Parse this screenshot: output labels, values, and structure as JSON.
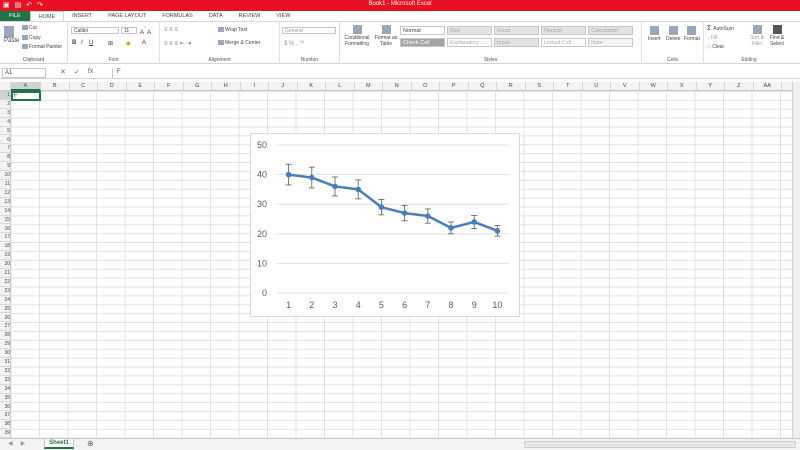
{
  "window": {
    "title": "Book1 - Microsoft Excel"
  },
  "tabs": [
    "FILE",
    "HOME",
    "INSERT",
    "PAGE LAYOUT",
    "FORMULAS",
    "DATA",
    "REVIEW",
    "VIEW"
  ],
  "ribbon": {
    "clipboard": {
      "paste": "Paste",
      "cut": "Cut",
      "copy": "Copy",
      "format_painter": "Format Painter",
      "label": "Clipboard"
    },
    "font": {
      "name": "Calibri",
      "size": "11",
      "label": "Font"
    },
    "alignment": {
      "wrap": "Wrap Text",
      "merge": "Merge & Center",
      "label": "Alignment"
    },
    "number": {
      "format": "General",
      "label": "Number"
    },
    "styles": {
      "conditional": "Conditional Formatting",
      "format_table": "Format as Table",
      "normal": "Normal",
      "bad": "Bad",
      "good": "Good",
      "neutral": "Neutral",
      "calculation": "Calculation",
      "check_cell": "Check Cell",
      "explanatory": "Explanatory ...",
      "input": "Input",
      "linked_cell": "Linked Cell",
      "note": "Note",
      "label": "Styles"
    },
    "cells": {
      "insert": "Insert",
      "delete": "Delete",
      "format": "Format",
      "label": "Cells"
    },
    "editing": {
      "autosum": "AutoSum",
      "fill": "Fill",
      "clear": "Clear",
      "sort": "Sort & Filter",
      "find": "Find & Select",
      "label": "Editing"
    }
  },
  "formula_bar": {
    "name_box": "A1",
    "content": "F"
  },
  "active_cell_value": "F",
  "columns": [
    "A",
    "B",
    "C",
    "D",
    "E",
    "F",
    "G",
    "H",
    "I",
    "J",
    "K",
    "L",
    "M",
    "N",
    "O",
    "P",
    "Q",
    "R",
    "S",
    "T",
    "U",
    "V",
    "W",
    "X",
    "Y",
    "Z",
    "AA",
    "AB"
  ],
  "rows": [
    "1",
    "2",
    "3",
    "4",
    "5",
    "6",
    "7",
    "8",
    "9",
    "10",
    "11",
    "12",
    "13",
    "14",
    "15",
    "16",
    "17",
    "18",
    "19",
    "20",
    "21",
    "22",
    "23",
    "24",
    "25",
    "26",
    "27",
    "28",
    "29",
    "30",
    "31",
    "32",
    "33",
    "34",
    "35",
    "36",
    "37",
    "38",
    "39"
  ],
  "sheet": {
    "name": "Sheet1"
  },
  "colors": {
    "excel_green": "#217346",
    "series": "#4a7ebb",
    "titlebar": "#e81123"
  },
  "chart_data": {
    "type": "line",
    "x": [
      1,
      2,
      3,
      4,
      5,
      6,
      7,
      8,
      9,
      10
    ],
    "series": [
      {
        "values": [
          40,
          39,
          36,
          35,
          29,
          27,
          26,
          22,
          24,
          21
        ],
        "error": [
          3.5,
          3.5,
          3.2,
          3.2,
          2.6,
          2.6,
          2.4,
          2.0,
          2.2,
          1.8
        ]
      }
    ],
    "ylim": [
      0,
      50
    ],
    "yticks": [
      0,
      10,
      20,
      30,
      40,
      50
    ],
    "grid": true,
    "legend": "none",
    "error_bars": true
  }
}
